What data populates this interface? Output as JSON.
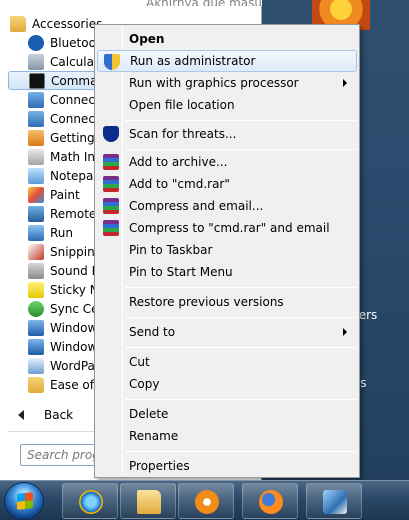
{
  "background": {
    "doc_text": "Akhirnya gue masuk ke situ aplikasi dan",
    "right_label_1": "ters",
    "right_label_2": "ss"
  },
  "start_menu": {
    "folder_label": "Accessories",
    "items": [
      {
        "label": "Bluetooth",
        "icon": "bluetooth-icon"
      },
      {
        "label": "Calculator",
        "icon": "calculator-icon"
      },
      {
        "label": "Command Prompt",
        "icon": "command-prompt-icon"
      },
      {
        "label": "Connect to a Network Projector",
        "icon": "connect-icon"
      },
      {
        "label": "Connect to a Projector",
        "icon": "connect-icon"
      },
      {
        "label": "Getting Started",
        "icon": "getting-started-icon"
      },
      {
        "label": "Math Input Panel",
        "icon": "math-input-icon"
      },
      {
        "label": "Notepad",
        "icon": "notepad-icon"
      },
      {
        "label": "Paint",
        "icon": "paint-icon"
      },
      {
        "label": "Remote Desktop Connection",
        "icon": "remote-desktop-icon"
      },
      {
        "label": "Run",
        "icon": "run-icon"
      },
      {
        "label": "Snipping Tool",
        "icon": "snipping-tool-icon"
      },
      {
        "label": "Sound Recorder",
        "icon": "sound-recorder-icon"
      },
      {
        "label": "Sticky Notes",
        "icon": "sticky-notes-icon"
      },
      {
        "label": "Sync Center",
        "icon": "sync-center-icon"
      },
      {
        "label": "Windows Explorer",
        "icon": "windows-explorer-icon"
      },
      {
        "label": "Windows Mobility Center",
        "icon": "windows-mobility-icon"
      },
      {
        "label": "WordPad",
        "icon": "wordpad-icon"
      },
      {
        "label": "Ease of Access",
        "icon": "folder-icon"
      }
    ],
    "back_label": "Back",
    "search_placeholder": "Search programs and files"
  },
  "context_menu": {
    "items": [
      {
        "label": "Open",
        "bold": true,
        "icon": null,
        "submenu": false
      },
      {
        "label": "Run as administrator",
        "bold": false,
        "icon": "uac-shield-icon",
        "submenu": false,
        "hover": true
      },
      {
        "label": "Run with graphics processor",
        "bold": false,
        "icon": null,
        "submenu": true
      },
      {
        "label": "Open file location",
        "bold": false,
        "icon": null,
        "submenu": false
      },
      {
        "label": "Scan for threats...",
        "bold": false,
        "icon": "antivirus-scan-icon",
        "submenu": false
      },
      {
        "label": "Add to archive...",
        "bold": false,
        "icon": "winrar-icon",
        "submenu": false
      },
      {
        "label": "Add to \"cmd.rar\"",
        "bold": false,
        "icon": "winrar-icon",
        "submenu": false
      },
      {
        "label": "Compress and email...",
        "bold": false,
        "icon": "winrar-icon",
        "submenu": false
      },
      {
        "label": "Compress to \"cmd.rar\" and email",
        "bold": false,
        "icon": "winrar-icon",
        "submenu": false
      },
      {
        "label": "Pin to Taskbar",
        "bold": false,
        "icon": null,
        "submenu": false
      },
      {
        "label": "Pin to Start Menu",
        "bold": false,
        "icon": null,
        "submenu": false
      },
      {
        "label": "Restore previous versions",
        "bold": false,
        "icon": null,
        "submenu": false
      },
      {
        "label": "Send to",
        "bold": false,
        "icon": null,
        "submenu": true
      },
      {
        "label": "Cut",
        "bold": false,
        "icon": null,
        "submenu": false
      },
      {
        "label": "Copy",
        "bold": false,
        "icon": null,
        "submenu": false
      },
      {
        "label": "Delete",
        "bold": false,
        "icon": null,
        "submenu": false
      },
      {
        "label": "Rename",
        "bold": false,
        "icon": null,
        "submenu": false
      },
      {
        "label": "Properties",
        "bold": false,
        "icon": null,
        "submenu": false
      }
    ]
  },
  "taskbar": {
    "start_button": "windows-start-icon",
    "pinned": [
      "internet-explorer-icon",
      "windows-explorer-icon",
      "media-player-icon",
      "firefox-icon",
      "media-center-icon"
    ]
  }
}
